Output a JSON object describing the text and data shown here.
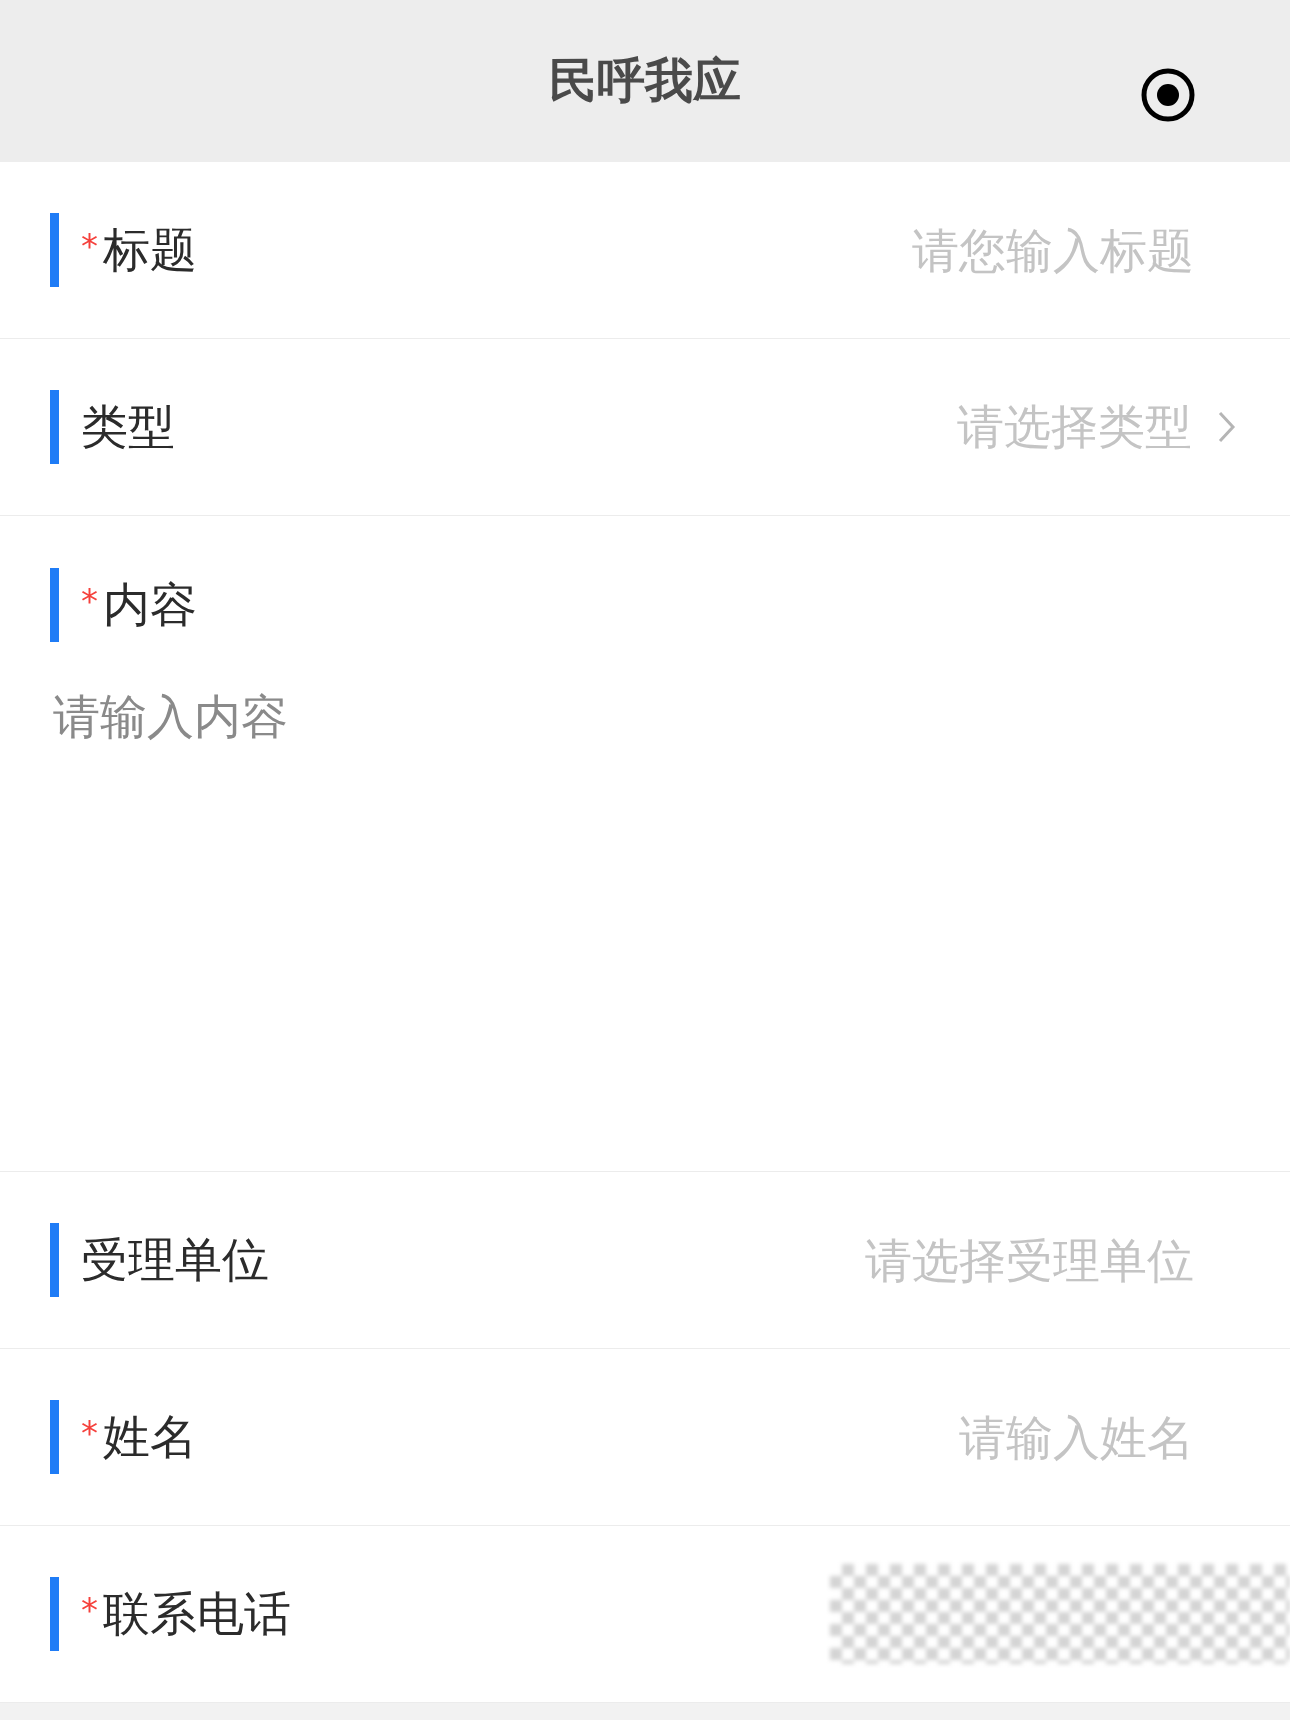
{
  "header": {
    "title": "民呼我应"
  },
  "required_mark": "*",
  "fields": [
    {
      "kind": "text",
      "required": true,
      "label": "标题",
      "placeholder": "请您输入标题"
    },
    {
      "kind": "select",
      "required": false,
      "label": "类型",
      "placeholder": "请选择类型"
    },
    {
      "kind": "textarea",
      "required": true,
      "label": "内容",
      "placeholder": "请输入内容"
    },
    {
      "kind": "text",
      "required": false,
      "label": "受理单位",
      "placeholder": "请选择受理单位"
    },
    {
      "kind": "text",
      "required": true,
      "label": "姓名",
      "placeholder": "请输入姓名"
    },
    {
      "kind": "text",
      "required": true,
      "label": "联系电话",
      "redacted": true
    }
  ]
}
